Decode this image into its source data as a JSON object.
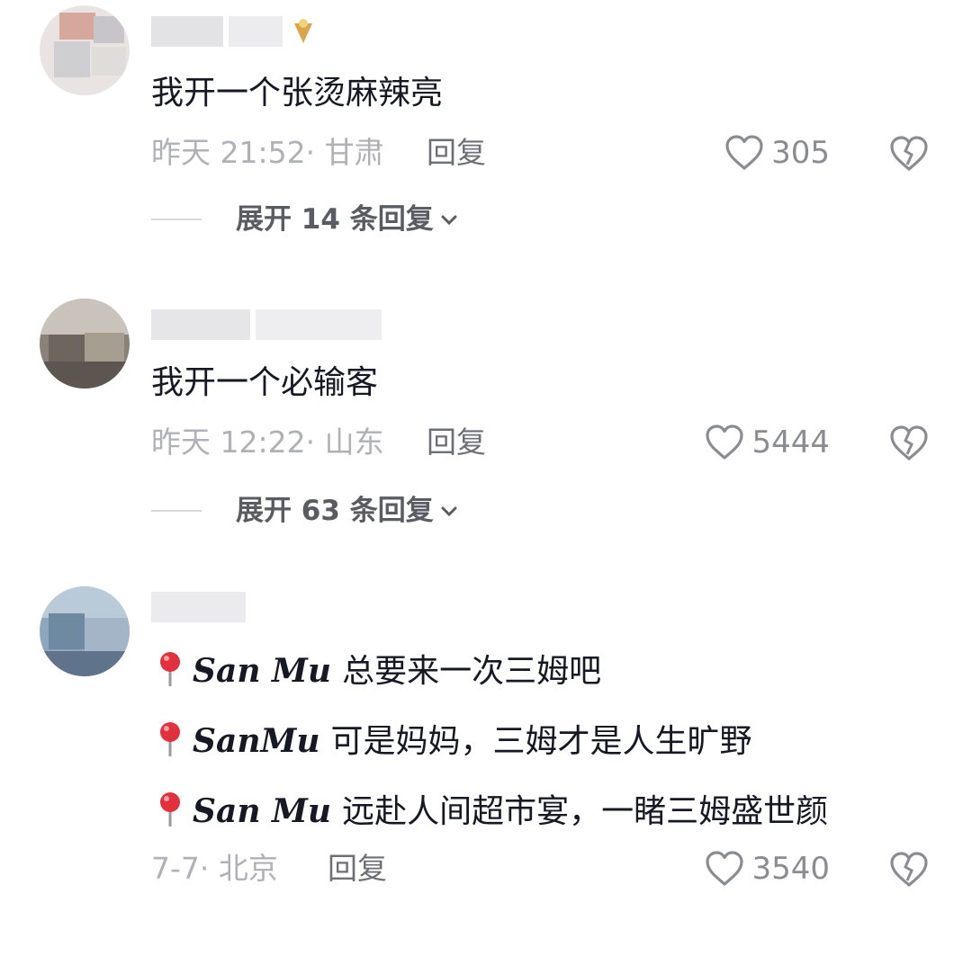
{
  "comments": [
    {
      "text": "我开一个张烫麻辣亮",
      "meta": "昨天 21:52· 甘肃",
      "reply": "回复",
      "likes": "305",
      "expand": "展开 14 条回复"
    },
    {
      "text": "我开一个必输客",
      "meta": "昨天 12:22· 山东",
      "reply": "回复",
      "likes": "5444",
      "expand": "展开 63 条回复"
    },
    {
      "lines": [
        {
          "brand": "San Mu",
          "text": "总要来一次三姆吧"
        },
        {
          "brand": "SanMu",
          "text": "可是妈妈，三姆才是人生旷野"
        },
        {
          "brand": "San Mu",
          "text": "远赴人间超市宴，一睹三姆盛世颜"
        }
      ],
      "meta": "7-7· 北京",
      "reply": "回复",
      "likes": "3540"
    }
  ],
  "icons": {
    "like": "heart-outline-icon",
    "dislike": "broken-heart-icon",
    "pin": "round-pushpin-icon",
    "expand": "chevron-down-icon"
  }
}
